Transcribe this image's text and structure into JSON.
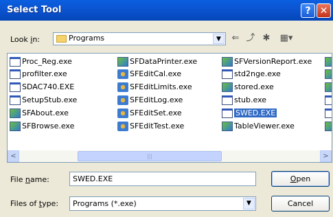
{
  "window": {
    "title": "Select Tool",
    "help_glyph": "?",
    "close_glyph": "✕"
  },
  "lookin": {
    "label_pre": "Look ",
    "label_key": "i",
    "label_post": "n:",
    "value": "Programs"
  },
  "toolbar": {
    "back_glyph": "⇐",
    "up_glyph": "⤴",
    "newfolder_glyph": "✱",
    "view_glyph": "▦▾"
  },
  "files": {
    "col1": [
      "Proc_Reg.exe",
      "profilter.exe",
      "SDAC740.EXE",
      "SetupStub.exe",
      "SFAbout.exe",
      "SFBrowse.exe"
    ],
    "col2": [
      "SFDataPrinter.exe",
      "SFEditCal.exe",
      "SFEditLimits.exe",
      "SFEditLog.exe",
      "SFEditSet.exe",
      "SFEditTest.exe"
    ],
    "col3": [
      "SFVersionReport.exe",
      "std2nge.exe",
      "stored.exe",
      "stub.exe",
      "SWED.EXE",
      "TableViewer.exe"
    ],
    "selected": "SWED.EXE"
  },
  "filename": {
    "label_pre": "File ",
    "label_key": "n",
    "label_post": "ame:",
    "value": "SWED.EXE"
  },
  "filetype": {
    "label_pre": "Files of ",
    "label_key": "t",
    "label_post": "ype:",
    "value": "Programs (*.exe)"
  },
  "buttons": {
    "open_key": "O",
    "open_rest": "pen",
    "cancel": "Cancel"
  },
  "scrollbar": {
    "left_glyph": "<",
    "right_glyph": ">",
    "grip": "|||"
  }
}
